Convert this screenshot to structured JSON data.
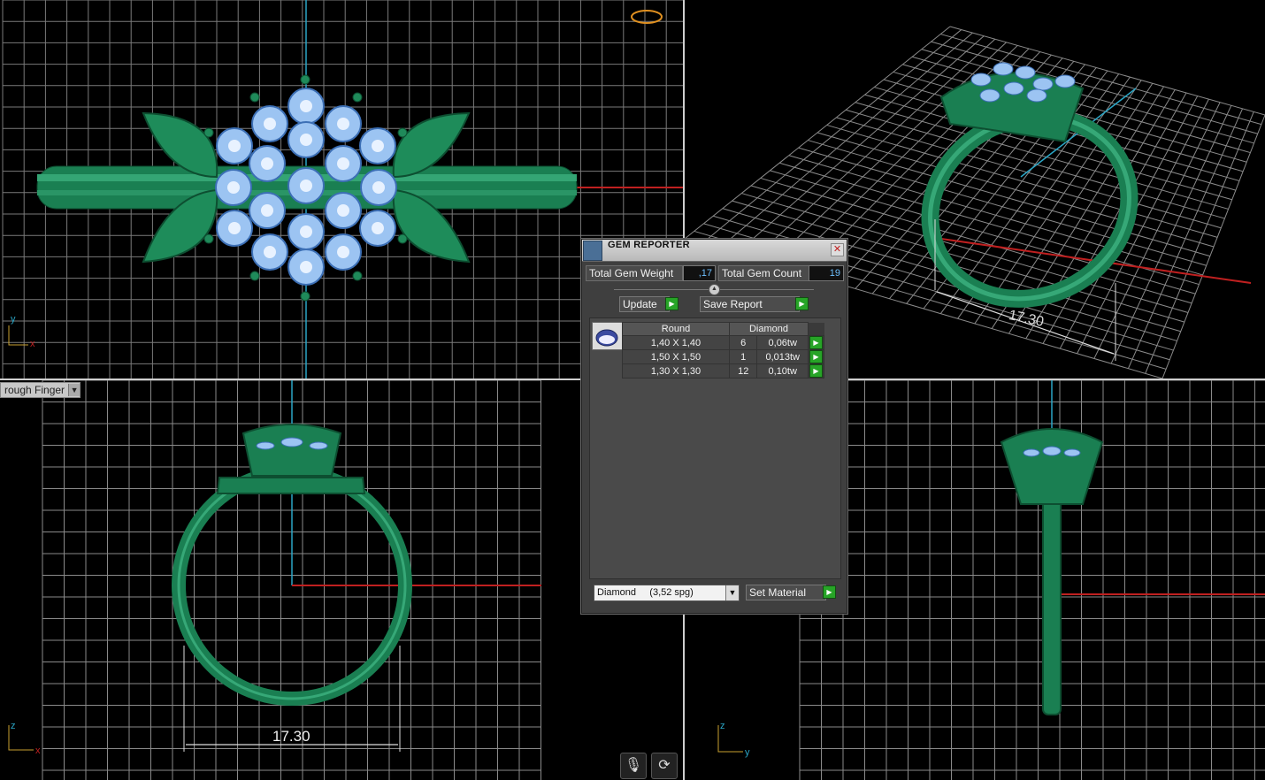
{
  "viewports": {
    "top": {
      "axis_labels": [
        "y",
        "x"
      ]
    },
    "perspective": {
      "dimension_label": "17.30"
    },
    "front": {
      "dropdown_value": "rough Finger",
      "dimension_label": "17.30",
      "axis_labels": [
        "z",
        "x"
      ]
    },
    "right": {
      "axis_labels": [
        "z",
        "y"
      ]
    }
  },
  "gem_reporter": {
    "title": "GEM REPORTER",
    "close_glyph": "✕",
    "total_weight_label": "Total Gem Weight",
    "total_weight_value": ",17",
    "total_count_label": "Total Gem Count",
    "total_count_value": "19",
    "update_label": "Update",
    "save_report_label": "Save Report",
    "table": {
      "headers": [
        "Round",
        "Diamond"
      ],
      "rows": [
        {
          "size": "1,40 X 1,40",
          "count": "6",
          "weight": "0,06tw"
        },
        {
          "size": "1,50 X 1,50",
          "count": "1",
          "weight": "0,013tw"
        },
        {
          "size": "1,30 X 1,30",
          "count": "12",
          "weight": "0,10tw"
        }
      ]
    },
    "material_value": "Diamond     (3,52 spg)",
    "set_material_label": "Set Material"
  },
  "bottom_toolbar": {
    "mic_icon": "microphone-icon",
    "rotate_icon": "refresh-icon"
  },
  "colors": {
    "ring_green": "#1f8a5a",
    "gem_blue": "#9cc4f2",
    "grid": "#8a8a8a",
    "axis_red": "#c02020",
    "axis_cyan": "#2aa6c6"
  }
}
